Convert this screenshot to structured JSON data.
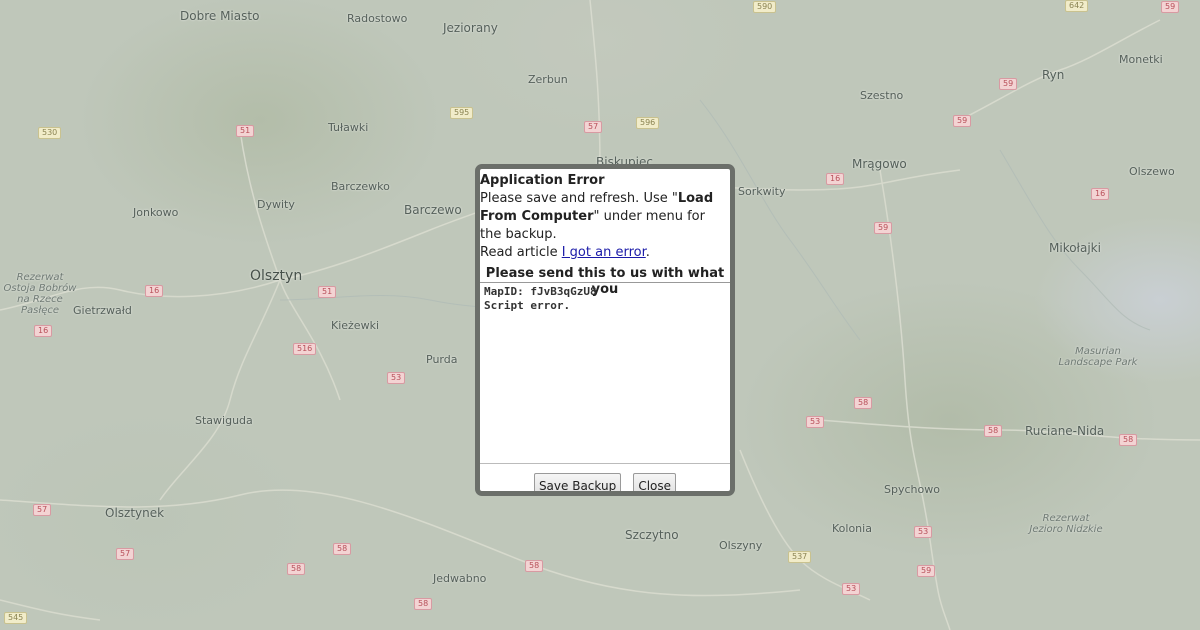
{
  "map": {
    "places": [
      {
        "name": "Dobre Miasto",
        "cls": "med"
      },
      {
        "name": "Radostowo",
        "cls": ""
      },
      {
        "name": "Jeziorany",
        "cls": "med"
      },
      {
        "name": "Zerbun",
        "cls": ""
      },
      {
        "name": "Tuławki",
        "cls": ""
      },
      {
        "name": "Barczewko",
        "cls": ""
      },
      {
        "name": "Jonkowo",
        "cls": ""
      },
      {
        "name": "Dywity",
        "cls": ""
      },
      {
        "name": "Barczewo",
        "cls": "med"
      },
      {
        "name": "Olsztyn",
        "cls": "big"
      },
      {
        "name": "Gietrzwałd",
        "cls": ""
      },
      {
        "name": "Kieżewki",
        "cls": ""
      },
      {
        "name": "Purda",
        "cls": ""
      },
      {
        "name": "Stawiguda",
        "cls": ""
      },
      {
        "name": "Olsztynek",
        "cls": "med"
      },
      {
        "name": "Jedwabno",
        "cls": ""
      },
      {
        "name": "Szczytno",
        "cls": "med"
      },
      {
        "name": "Olszyny",
        "cls": ""
      },
      {
        "name": "Biskupiec",
        "cls": "med"
      },
      {
        "name": "Sorkwity",
        "cls": ""
      },
      {
        "name": "Mrągowo",
        "cls": "med"
      },
      {
        "name": "Szestno",
        "cls": ""
      },
      {
        "name": "Ryn",
        "cls": "med"
      },
      {
        "name": "Monetki",
        "cls": ""
      },
      {
        "name": "Olszewo",
        "cls": ""
      },
      {
        "name": "Mikołajki",
        "cls": "med"
      },
      {
        "name": "Spychowo",
        "cls": ""
      },
      {
        "name": "Kolonia",
        "cls": ""
      },
      {
        "name": "Ruciane-Nida",
        "cls": "med"
      },
      {
        "name": "Masurian Landscape Park",
        "cls": "ital"
      },
      {
        "name": "Rezerwat Jezioro Nidzkie",
        "cls": "ital"
      },
      {
        "name": "Rezerwat Ostoja Bobrów na Rzece Pasłęce",
        "cls": "ital"
      }
    ],
    "shields": [
      {
        "label": "590",
        "color": "yellow"
      },
      {
        "label": "642",
        "color": "yellow"
      },
      {
        "label": "59",
        "color": "red"
      },
      {
        "label": "530",
        "color": "yellow"
      },
      {
        "label": "51",
        "color": "red"
      },
      {
        "label": "595",
        "color": "yellow"
      },
      {
        "label": "57",
        "color": "red"
      },
      {
        "label": "596",
        "color": "yellow"
      },
      {
        "label": "59",
        "color": "red"
      },
      {
        "label": "59",
        "color": "red"
      },
      {
        "label": "16",
        "color": "red"
      },
      {
        "label": "16",
        "color": "red"
      },
      {
        "label": "59",
        "color": "red"
      },
      {
        "label": "16",
        "color": "red"
      },
      {
        "label": "16",
        "color": "red"
      },
      {
        "label": "51",
        "color": "red"
      },
      {
        "label": "516",
        "color": "red"
      },
      {
        "label": "53",
        "color": "red"
      },
      {
        "label": "53",
        "color": "red"
      },
      {
        "label": "58",
        "color": "red"
      },
      {
        "label": "58",
        "color": "red"
      },
      {
        "label": "58",
        "color": "red"
      },
      {
        "label": "57",
        "color": "red"
      },
      {
        "label": "57",
        "color": "red"
      },
      {
        "label": "58",
        "color": "red"
      },
      {
        "label": "58",
        "color": "red"
      },
      {
        "label": "58",
        "color": "red"
      },
      {
        "label": "58",
        "color": "red"
      },
      {
        "label": "545",
        "color": "yellow"
      },
      {
        "label": "537",
        "color": "yellow"
      },
      {
        "label": "53",
        "color": "red"
      },
      {
        "label": "53",
        "color": "red"
      },
      {
        "label": "59",
        "color": "red"
      },
      {
        "label": "59",
        "color": "red"
      }
    ]
  },
  "dialog": {
    "title": "Application Error",
    "line1_pre": "Please save and refresh. Use \"",
    "line1_bold": "Load From Computer",
    "line1_post": "\" under menu for the backup.",
    "read_pre": "Read article ",
    "read_link": "I got an error",
    "read_post": ".",
    "send_heading": "Please send this to us with what you",
    "error_log": "MapID: fJvB3qGzU8\nScript error.",
    "save_button": "Save Backup",
    "close_button": "Close"
  }
}
